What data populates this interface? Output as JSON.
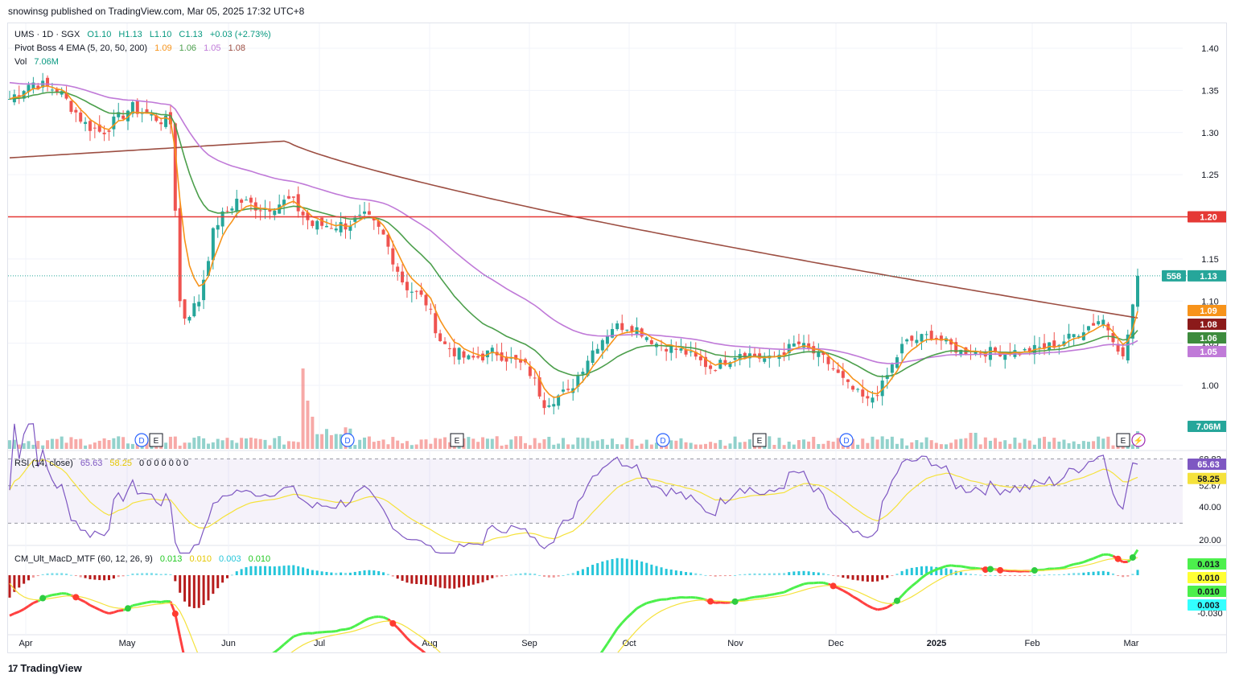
{
  "header": {
    "publish_line": "snowinsg published on TradingView.com, Mar 05, 2025 17:32 UTC+8"
  },
  "footer": {
    "brand": "TradingView"
  },
  "legend": {
    "symbol_line": {
      "symbol": "UMS · 1D · SGX",
      "o": "O1.10",
      "h": "H1.13",
      "l": "L1.10",
      "c": "C1.13",
      "change": "+0.03 (+2.73%)"
    },
    "ema_line": {
      "name": "Pivot Boss 4 EMA (5, 20, 50, 200)",
      "v5": "1.09",
      "v20": "1.06",
      "v50": "1.05",
      "v200": "1.08"
    },
    "vol_line": {
      "name": "Vol",
      "value": "7.06M"
    }
  },
  "colors": {
    "up": "#26a69a",
    "down": "#ef5350",
    "ema5": "#f7931a",
    "ema20": "#4c9f4c",
    "ema50": "#c07ad8",
    "ema200": "#9c4e42",
    "resistance": "#e53935",
    "rsi": "#7e57c2",
    "rsi_ma": "#f5e23c",
    "macd_up": "#4cf04c",
    "macd_down": "#ff4040"
  },
  "price_axis": {
    "ticks": [
      "1.40",
      "1.35",
      "1.30",
      "1.25",
      "1.20",
      "1.15",
      "1.10",
      "1.05",
      "1.00"
    ]
  },
  "price_labels": {
    "resistance": "1.20",
    "last_volume": "558",
    "last": "1.13",
    "ema5": "1.09",
    "ema200": "1.08",
    "ema20": "1.06",
    "ema50": "1.05",
    "volume": "7.06M"
  },
  "events": [
    {
      "kind": "D",
      "date": "Apr 30"
    },
    {
      "kind": "E",
      "date": "May 3"
    },
    {
      "kind": "D",
      "date": "Jul 3"
    },
    {
      "kind": "E",
      "date": "Aug 12"
    },
    {
      "kind": "D",
      "date": "Oct 3"
    },
    {
      "kind": "E",
      "date": "Nov 12"
    },
    {
      "kind": "D",
      "date": "Dec 2"
    },
    {
      "kind": "E",
      "date": "Feb 28"
    }
  ],
  "rsi_pane": {
    "label": "RSI (14, close)",
    "value": "65.63",
    "ma_value": "58.25",
    "extra": "0 0 0 0 0 0 0",
    "axis_ticks": [
      "68.82",
      "52.67",
      "40.00",
      "20.00"
    ],
    "value_label": "65.63",
    "ma_label": "58.25"
  },
  "macd_pane": {
    "label": "CM_Ult_MacD_MTF (60, 12, 26, 9)",
    "v1": "0.013",
    "v2": "0.010",
    "v3": "0.003",
    "v4": "0.010",
    "labels": [
      "0.013",
      "0.010",
      "0.010",
      "0.003"
    ],
    "axis_tick": "-0.030"
  },
  "time_axis": [
    "Apr",
    "May",
    "Jun",
    "Jul",
    "Aug",
    "Sep",
    "Oct",
    "Nov",
    "Dec",
    "2025",
    "Feb",
    "Mar"
  ],
  "chart_data": {
    "type": "candlestick",
    "symbol": "UMS",
    "timeframe": "1D",
    "ylim": [
      0.96,
      1.42
    ],
    "ohlc_monthly_points": [
      {
        "x": "Apr 1",
        "close": 1.35
      },
      {
        "x": "Apr 15",
        "close": 1.31
      },
      {
        "x": "May 1",
        "close": 1.32
      },
      {
        "x": "May 9",
        "close": 1.27
      },
      {
        "x": "May 10",
        "close": 1.1
      },
      {
        "x": "May 20",
        "close": 1.07
      },
      {
        "x": "Jun 5",
        "close": 1.22
      },
      {
        "x": "Jun 20",
        "close": 1.22
      },
      {
        "x": "Jul 5",
        "close": 1.18
      },
      {
        "x": "Jul 20",
        "close": 1.19
      },
      {
        "x": "Aug 1",
        "close": 1.12
      },
      {
        "x": "Aug 15",
        "close": 1.04
      },
      {
        "x": "Sep 10",
        "close": 0.98
      },
      {
        "x": "Oct 1",
        "close": 1.07
      },
      {
        "x": "Nov 1",
        "close": 1.04
      },
      {
        "x": "Dec 1",
        "close": 1.03
      },
      {
        "x": "Dec 20",
        "close": 0.98
      },
      {
        "x": "Jan 5",
        "close": 1.05
      },
      {
        "x": "Feb 1",
        "close": 1.04
      },
      {
        "x": "Feb 20",
        "close": 1.07
      },
      {
        "x": "Mar 3",
        "close": 1.03
      },
      {
        "x": "Mar 5",
        "close": 1.13
      }
    ],
    "resistance_level": 1.2,
    "last_price": 1.13,
    "ema": {
      "5": 1.09,
      "20": 1.06,
      "50": 1.05,
      "200": 1.08
    },
    "volume_last": "7.06M",
    "rsi_last": 65.63,
    "rsi_ma_last": 58.25,
    "macd_last": [
      0.013,
      0.01,
      0.003,
      0.01
    ]
  }
}
